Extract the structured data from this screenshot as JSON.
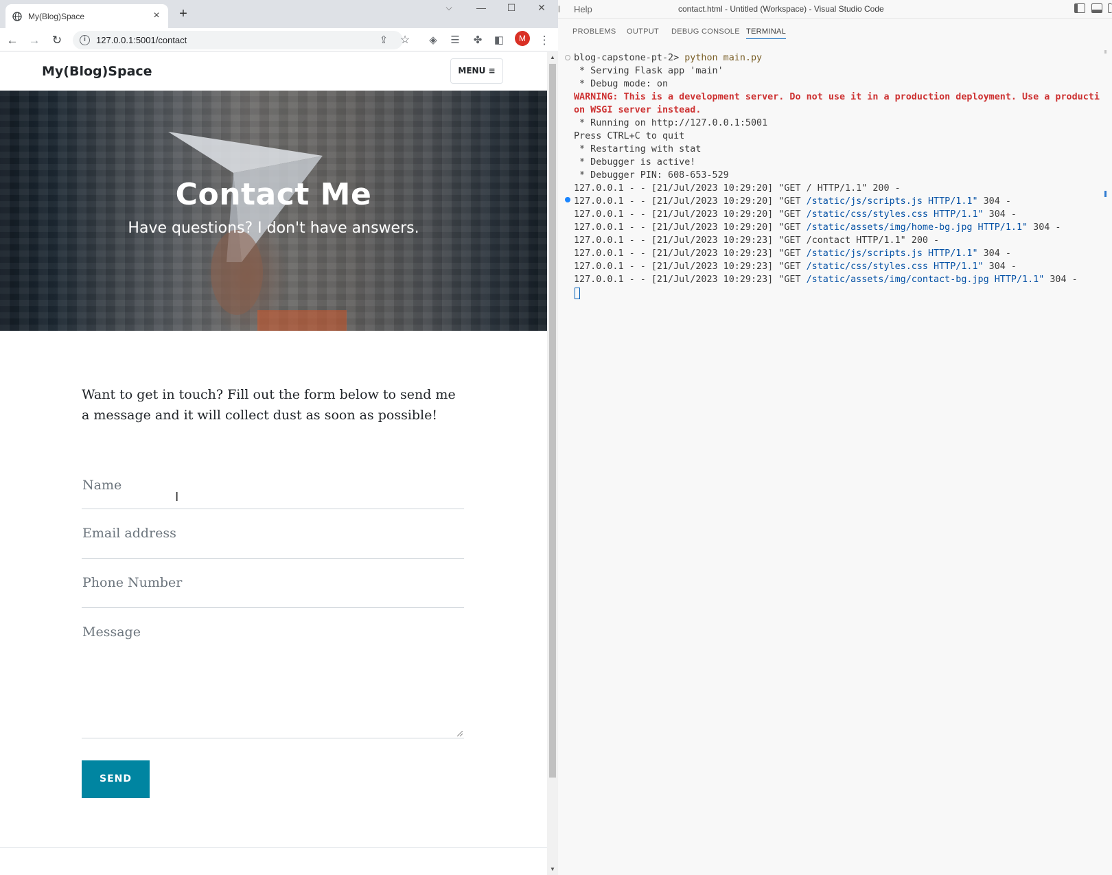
{
  "browser": {
    "tab": {
      "title": "My(Blog)Space",
      "close_icon": "close-icon"
    },
    "new_tab_icon": "plus-icon",
    "window_controls": {
      "dropdown": "⌵",
      "minimize": "—",
      "maximize": "☐",
      "close": "✕"
    },
    "toolbar": {
      "back": "←",
      "forward": "→",
      "reload": "↻",
      "url": "127.0.0.1:5001/contact",
      "share_icon": "share-icon",
      "bookmark_icon": "star-icon",
      "profile_initial": "M",
      "more_icon": "kebab-menu-icon"
    }
  },
  "site": {
    "brand": "My(Blog)Space",
    "menu_label": "MENU ≡",
    "hero": {
      "title": "Contact Me",
      "subtitle": "Have questions? I don't have answers."
    },
    "intro": "Want to get in touch? Fill out the form below to send me a message and it will collect dust as soon as possible!",
    "form": {
      "name_placeholder": "Name",
      "email_placeholder": "Email address",
      "phone_placeholder": "Phone Number",
      "message_placeholder": "Message",
      "submit_label": "SEND"
    },
    "accent_color": "#0085a1"
  },
  "vscode": {
    "menu_partial": "l",
    "menu_help": "Help",
    "window_title": "contact.html - Untitled (Workspace) - Visual Studio Code",
    "panel_tabs": [
      "PROBLEMS",
      "OUTPUT",
      "DEBUG CONSOLE",
      "TERMINAL"
    ],
    "active_tab": "TERMINAL",
    "terminal": {
      "prompt": "blog-capstone-pt-2>",
      "command": "python main.py",
      "serving": " * Serving Flask app 'main'",
      "debug_mode": " * Debug mode: on",
      "warning_1": "WARNING: This is a development server. Do not use it in a production deployment. Use a producti",
      "warning_2": "on WSGI server instead.",
      "running": " * Running on http://127.0.0.1:5001",
      "quit": "Press CTRL+C to quit",
      "restart": " * Restarting with stat",
      "debugger_active": " * Debugger is active!",
      "debugger_pin": " * Debugger PIN: 608-653-529",
      "requests": [
        {
          "prefix": "127.0.0.1 - - [21/Jul/2023 10:29:20] ",
          "method": "\"GET",
          "path": " / ",
          "proto": "HTTP/1.1\"",
          "status": " 200 -"
        },
        {
          "prefix": "127.0.0.1 - - [21/Jul/2023 10:29:20] ",
          "method": "\"GET",
          "path": " /static/js/scripts.js HTTP/1.1\"",
          "proto": "",
          "status": " 304 -"
        },
        {
          "prefix": "127.0.0.1 - - [21/Jul/2023 10:29:20] ",
          "method": "\"GET",
          "path": " /static/css/styles.css HTTP/1.1\"",
          "proto": "",
          "status": " 304 -"
        },
        {
          "prefix": "127.0.0.1 - - [21/Jul/2023 10:29:20] ",
          "method": "\"GET",
          "path": " /static/assets/img/home-bg.jpg HTTP/1.1\"",
          "proto": "",
          "status": " 304 -"
        },
        {
          "prefix": "127.0.0.1 - - [21/Jul/2023 10:29:23] ",
          "method": "\"GET",
          "path": " /contact ",
          "proto": "HTTP/1.1\"",
          "status": " 200 -"
        },
        {
          "prefix": "127.0.0.1 - - [21/Jul/2023 10:29:23] ",
          "method": "\"GET",
          "path": " /static/js/scripts.js HTTP/1.1\"",
          "proto": "",
          "status": " 304 -"
        },
        {
          "prefix": "127.0.0.1 - - [21/Jul/2023 10:29:23] ",
          "method": "\"GET",
          "path": " /static/css/styles.css HTTP/1.1\"",
          "proto": "",
          "status": " 304 -"
        },
        {
          "prefix": "127.0.0.1 - - [21/Jul/2023 10:29:23] ",
          "method": "\"GET",
          "path": " /static/assets/img/contact-bg.jpg HTTP/1.1\"",
          "proto": "",
          "status": " 304 -"
        }
      ]
    }
  }
}
